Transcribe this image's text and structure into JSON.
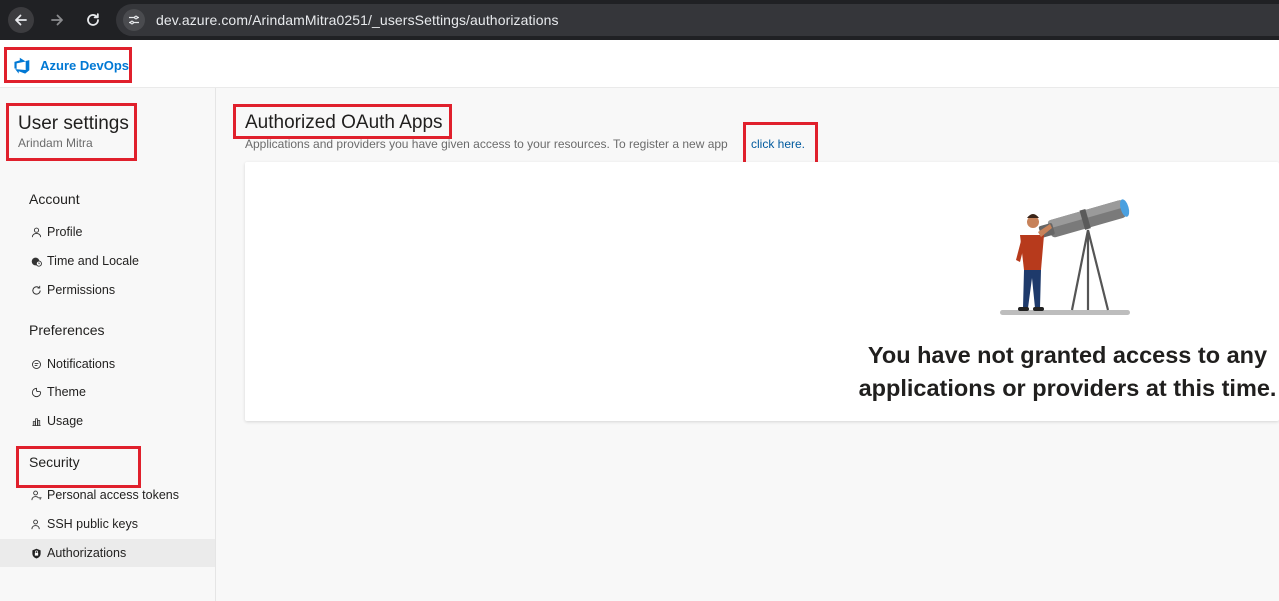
{
  "browser": {
    "url": "dev.azure.com/ArindamMitra0251/_usersSettings/authorizations"
  },
  "header": {
    "brand": "Azure DevOps",
    "brand_color": "#0078d4"
  },
  "sidebar": {
    "title": "User settings",
    "user_name": "Arindam Mitra",
    "sections": [
      {
        "label": "Account",
        "items": [
          {
            "label": "Profile",
            "icon": "profile-icon"
          },
          {
            "label": "Time and Locale",
            "icon": "globe-clock-icon"
          },
          {
            "label": "Permissions",
            "icon": "permissions-icon"
          }
        ]
      },
      {
        "label": "Preferences",
        "items": [
          {
            "label": "Notifications",
            "icon": "notification-icon"
          },
          {
            "label": "Theme",
            "icon": "theme-icon"
          },
          {
            "label": "Usage",
            "icon": "usage-icon"
          }
        ]
      },
      {
        "label": "Security",
        "items": [
          {
            "label": "Personal access tokens",
            "icon": "token-icon"
          },
          {
            "label": "SSH public keys",
            "icon": "key-icon"
          },
          {
            "label": "Authorizations",
            "icon": "lock-icon",
            "selected": true
          }
        ]
      }
    ]
  },
  "main": {
    "title": "Authorized OAuth Apps",
    "description": "Applications and providers you have given access to your resources. To register a new app",
    "link_text": "click here.",
    "empty_message": "You have not granted access to any applications or providers at this time."
  },
  "colors": {
    "highlight": "#e0202c",
    "link": "#005a9e",
    "selected_bg": "#ebebeb"
  }
}
